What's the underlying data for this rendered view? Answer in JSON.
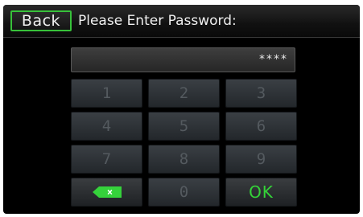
{
  "header": {
    "back_label": "Back",
    "title": "Please Enter Password:"
  },
  "password": {
    "masked_value": "****"
  },
  "keypad": {
    "keys": [
      "1",
      "2",
      "3",
      "4",
      "5",
      "6",
      "7",
      "8",
      "9"
    ],
    "zero": "0",
    "delete_glyph": "×",
    "ok_label": "OK"
  },
  "colors": {
    "accent": "#37c13a",
    "background": "#000000"
  }
}
